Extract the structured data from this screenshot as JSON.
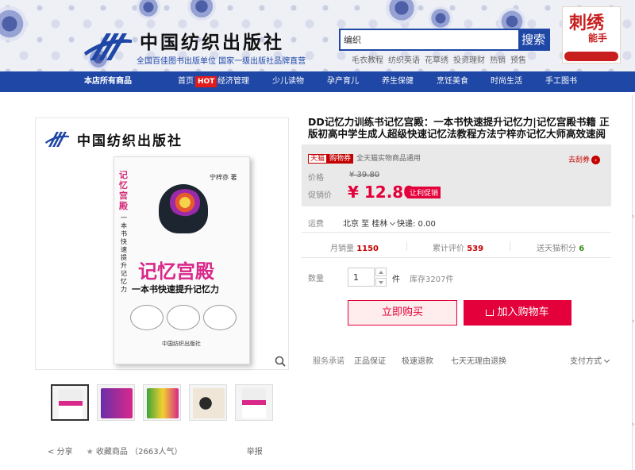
{
  "header": {
    "publisher_name": "中国纺织出版社",
    "publisher_slogan": "全国百佳图书出版单位  国家一级出版社品牌直营",
    "search": {
      "value": "编织",
      "button_label": "搜索"
    },
    "hot_words": [
      "毛衣教程",
      "纺织英语",
      "花草绣",
      "投资理财",
      "热销",
      "预售"
    ],
    "promo_box": {
      "title": "刺绣",
      "subtitle": "能手"
    }
  },
  "nav": {
    "all_products": "本店所有商品",
    "items": [
      "首页",
      "经济管理",
      "少儿读物",
      "孕产育儿",
      "养生保健",
      "烹饪美食",
      "时尚生活",
      "手工图书"
    ],
    "hot_badge": "HOT"
  },
  "gallery": {
    "publisher_name": "中国纺织出版社",
    "book": {
      "spine_title": "记忆宫殿",
      "spine_subtitle": "一本书快速提升记忆力",
      "author": "宁梓亦 著",
      "title": "记忆宫殿",
      "subtitle": "一本书快速提升记忆力",
      "publisher": "中国纺织出版社"
    },
    "thumb_count": 5,
    "share_label": "分享",
    "favorite_label": "收藏商品",
    "favorite_count": "（2663人气）",
    "report_label": "举报"
  },
  "product": {
    "title": "DD记忆力训练书记忆宫殿：一本书快速提升记忆力|记忆宫殿书籍 正版初高中学生成人超级快速记忆法教程方法宁梓亦记忆大师高效速阅",
    "tmall_label": "天猫",
    "coupon_tag": "购物券",
    "coupon_desc": "全天猫实物商品通用",
    "coupon_link": "去刮券",
    "price_label": "价格",
    "original_price": "¥ 39.80",
    "promo_label": "促销价",
    "current_price": "¥ 12.80",
    "promo_tag": "让利促销",
    "shipping_label": "运费",
    "shipping_from": "北京 至 桂林",
    "shipping_fee": "快递: 0.00",
    "stats": {
      "monthly_sales_label": "月销量",
      "monthly_sales": "1150",
      "reviews_label": "累计评价",
      "reviews": "539",
      "points_label": "送天猫积分",
      "points": "6"
    },
    "quantity_label": "数量",
    "quantity": "1",
    "unit": "件",
    "stock": "库存3207件",
    "buy_now": "立即购买",
    "add_to_cart": "加入购物车",
    "service_label": "服务承诺",
    "services": [
      "正品保证",
      "极速退款",
      "七天无理由退换"
    ],
    "payment_label": "支付方式"
  },
  "colors": {
    "brand_blue": "#1f47a6",
    "price_red": "#e4003a",
    "tmall_red": "#c40000"
  }
}
